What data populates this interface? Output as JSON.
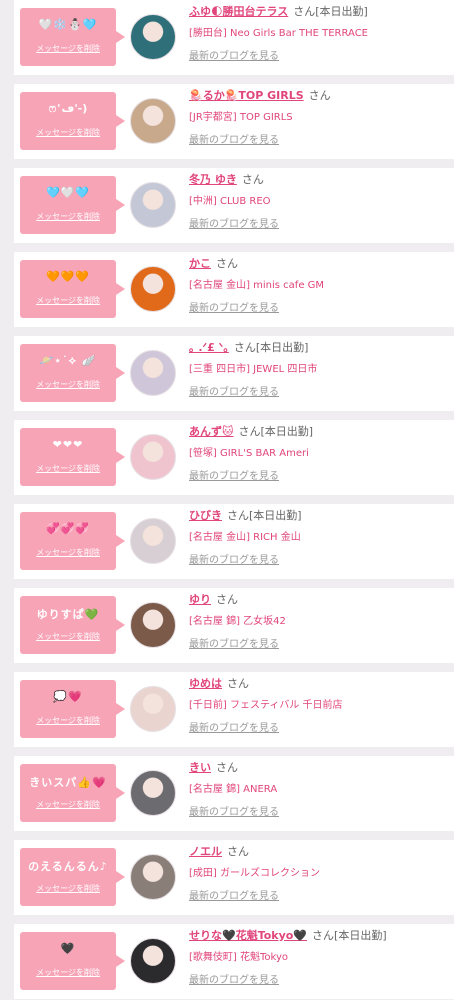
{
  "colors": {
    "accent": "#e0457b",
    "bubble": "#f7a4b7",
    "background": "#efedef"
  },
  "labels": {
    "delete_message": "メッセージを削除",
    "san": "さん",
    "latest_blog": "最新のブログを見る"
  },
  "entries": [
    {
      "message": "🤍❄️⛄🩵",
      "name": "ふゆ🌓勝田台テラス",
      "badge": "[本日出勤]",
      "shop": "[勝田台] Neo Girls Bar THE TERRACE",
      "avatar_color": "#2f6f7a"
    },
    {
      "message": "ෆ'ڡ'-)",
      "name": "🪼るか🪼TOP GIRLS",
      "badge": "",
      "shop": "[JR宇都宮] TOP GIRLS",
      "avatar_color": "#c8a98c"
    },
    {
      "message": "🩵🤍🩵",
      "name": "冬乃 ゆき",
      "badge": "",
      "shop": "[中洲] CLUB REO",
      "avatar_color": "#c3c7d6"
    },
    {
      "message": "🧡🧡🧡",
      "name": "かこ",
      "badge": "",
      "shop": "[名古屋 金山] minis cafe GM",
      "avatar_color": "#e06a1a"
    },
    {
      "message": "🪐⋆˙⟡ 🪽",
      "name": "｡ .ᐟ£ ᐠ｡",
      "badge": "[本日出勤]",
      "shop": "[三重 四日市] JEWEL 四日市",
      "avatar_color": "#cfc7d9"
    },
    {
      "message": "❤❤❤",
      "name": "あんず🐱",
      "badge": "[本日出勤]",
      "shop": "[笹塚] GIRL'S BAR Ameri",
      "avatar_color": "#f0c4cf"
    },
    {
      "message": "💞💞💞",
      "name": "ひびき",
      "badge": "[本日出勤]",
      "shop": "[名古屋 金山] RICH 金山",
      "avatar_color": "#d7cfd3"
    },
    {
      "message": "ゆりすぱ💚",
      "name": "ゆり",
      "badge": "",
      "shop": "[名古屋 錦] 乙女坂42",
      "avatar_color": "#7b5a49"
    },
    {
      "message": "💭💗",
      "name": "ゆめは",
      "badge": "",
      "shop": "[千日前] フェスティバル 千日前店",
      "avatar_color": "#e9d4cf"
    },
    {
      "message": "きいスパ👍💗",
      "name": "きい",
      "badge": "",
      "shop": "[名古屋 錦] ANERA",
      "avatar_color": "#6b6b70"
    },
    {
      "message": "のえるんるん♪",
      "name": "ノエル",
      "badge": "",
      "shop": "[成田] ガールズコレクション",
      "avatar_color": "#8a7f78"
    },
    {
      "message": "🖤",
      "name": "せりな🖤花魁Tokyo🖤",
      "badge": "[本日出勤]",
      "shop": "[歌舞伎町] 花魁Tokyo",
      "avatar_color": "#2b2b2e"
    }
  ]
}
